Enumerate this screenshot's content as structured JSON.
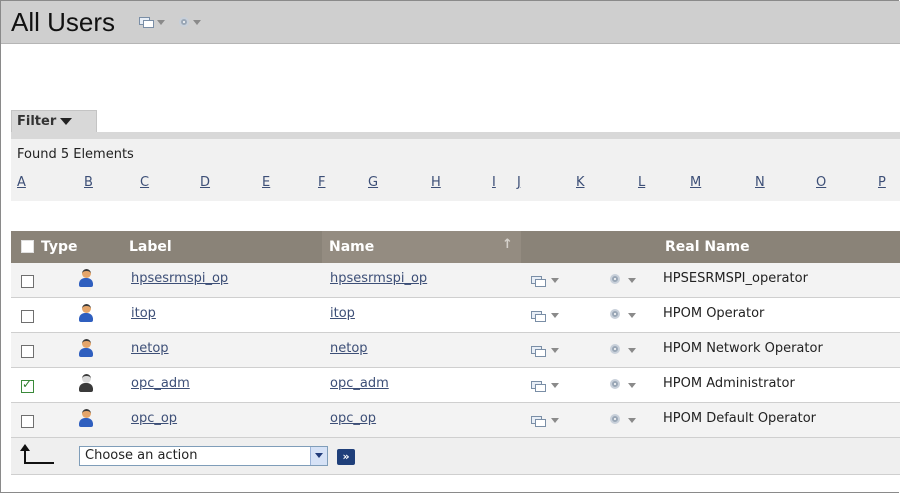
{
  "title": "All Users",
  "filter": {
    "label": "Filter"
  },
  "found_text": "Found 5 Elements",
  "letters": [
    "A",
    "B",
    "C",
    "D",
    "E",
    "F",
    "G",
    "H",
    "I",
    "J",
    "K",
    "L",
    "M",
    "N",
    "O",
    "P"
  ],
  "columns": {
    "type": "Type",
    "label": "Label",
    "name": "Name",
    "real_name": "Real Name"
  },
  "rows": [
    {
      "label": "hpsesrmspi_op",
      "name": "hpsesrmspi_op",
      "real_name": "HPSESRMSPI_operator",
      "checked": false,
      "icon": "operator-user-icon"
    },
    {
      "label": "itop",
      "name": "itop",
      "real_name": "HPOM Operator",
      "checked": false,
      "icon": "operator-user-icon"
    },
    {
      "label": "netop",
      "name": "netop",
      "real_name": "HPOM Network Operator",
      "checked": false,
      "icon": "operator-user-icon"
    },
    {
      "label": "opc_adm",
      "name": "opc_adm",
      "real_name": "HPOM Administrator",
      "checked": true,
      "icon": "admin-user-icon"
    },
    {
      "label": "opc_op",
      "name": "opc_op",
      "real_name": "HPOM Default Operator",
      "checked": false,
      "icon": "operator-user-icon"
    }
  ],
  "footer": {
    "action_select": "Choose an action",
    "go_label": "»"
  }
}
